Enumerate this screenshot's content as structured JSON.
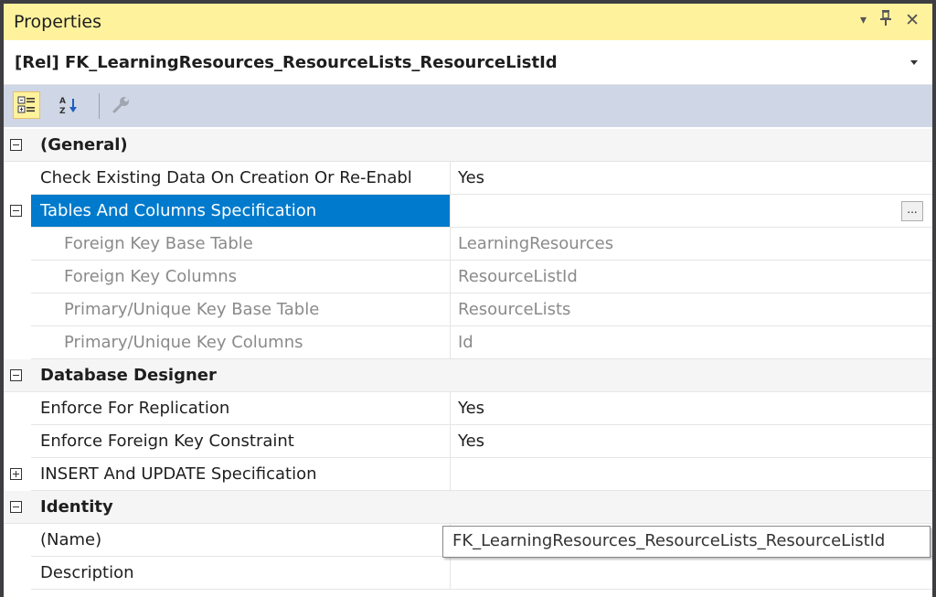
{
  "window": {
    "title": "Properties",
    "controls": {
      "dropdown_icon": "▾",
      "pin_icon": "⫧",
      "close_icon": "✕"
    }
  },
  "object_selector": {
    "value": "[Rel] FK_LearningResources_ResourceLists_ResourceListId"
  },
  "toolbar": {
    "buttons": [
      {
        "name": "categorized",
        "icon": "categorized-icon",
        "active": true
      },
      {
        "name": "alphabetical",
        "icon": "sort-az-icon",
        "active": false
      },
      {
        "name": "property-pages",
        "icon": "wrench-icon",
        "active": false,
        "disabled": true
      }
    ]
  },
  "grid": {
    "sections": [
      {
        "category": "(General)",
        "rows": [
          {
            "name": "Check Existing Data On Creation Or Re-Enabl",
            "value": "Yes"
          },
          {
            "name": "Tables And Columns Specification",
            "value": "",
            "selected": true,
            "expander": "minus",
            "ellipsis": "..."
          },
          {
            "name": "Foreign Key Base Table",
            "value": "LearningResources",
            "sub": true
          },
          {
            "name": "Foreign Key Columns",
            "value": "ResourceListId",
            "sub": true
          },
          {
            "name": "Primary/Unique Key Base Table",
            "value": "ResourceLists",
            "sub": true
          },
          {
            "name": "Primary/Unique Key Columns",
            "value": "Id",
            "sub": true
          }
        ]
      },
      {
        "category": "Database Designer",
        "rows": [
          {
            "name": "Enforce For Replication",
            "value": "Yes"
          },
          {
            "name": "Enforce Foreign Key Constraint",
            "value": "Yes"
          },
          {
            "name": "INSERT And UPDATE Specification",
            "value": "",
            "expander": "plus"
          }
        ]
      },
      {
        "category": "Identity",
        "rows": [
          {
            "name": "(Name)",
            "value": ""
          },
          {
            "name": "Description",
            "value": ""
          }
        ]
      }
    ]
  },
  "tooltip": {
    "text": "FK_LearningResources_ResourceLists_ResourceListId"
  },
  "colors": {
    "accent": "#fff29d",
    "selection": "#007acc",
    "toolbar": "#cfd6e5",
    "frame": "#3e3e42"
  }
}
